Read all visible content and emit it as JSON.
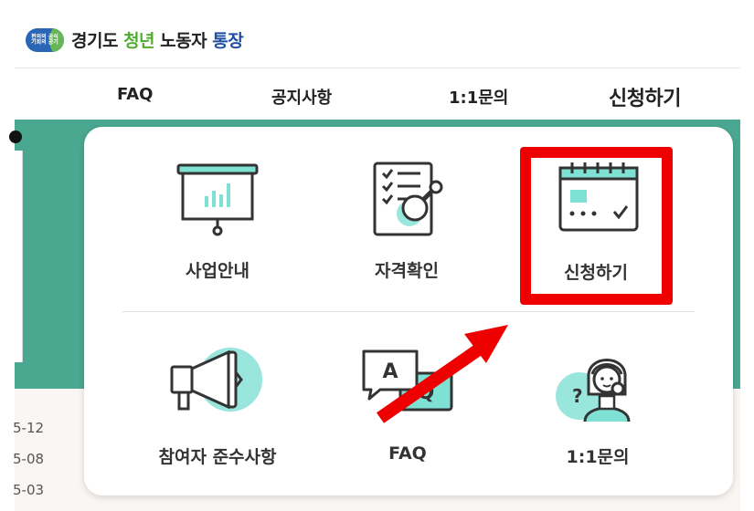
{
  "logo": {
    "badge_line1": "편의의 공식",
    "badge_line2": "기회의 공기",
    "text_a": "경기도",
    "text_b": "청년",
    "text_c": "노동자",
    "text_d": "통장"
  },
  "nav": {
    "faq": "FAQ",
    "notice": "공지사항",
    "inquiry": "1:1문의",
    "apply": "신청하기"
  },
  "background": {
    "dates": [
      "5-12",
      "5-08",
      "5-03"
    ]
  },
  "menu": {
    "business": "사업안내",
    "eligibility": "자격확인",
    "apply": "신청하기",
    "rules": "참여자 준수사항",
    "faq": "FAQ",
    "inquiry": "1:1문의",
    "faq_icon_letter_a": "A",
    "faq_icon_letter_q": "Q",
    "inquiry_icon_mark": "?"
  },
  "colors": {
    "accent_teal": "#4aa891",
    "highlight_red": "#ee0000",
    "icon_mint": "#7fe0d4"
  },
  "icons": [
    "presentation-chart-icon",
    "checklist-magnifier-icon",
    "calendar-icon",
    "megaphone-icon",
    "qa-speech-bubble-icon",
    "support-agent-icon",
    "red-arrow-annotation"
  ]
}
